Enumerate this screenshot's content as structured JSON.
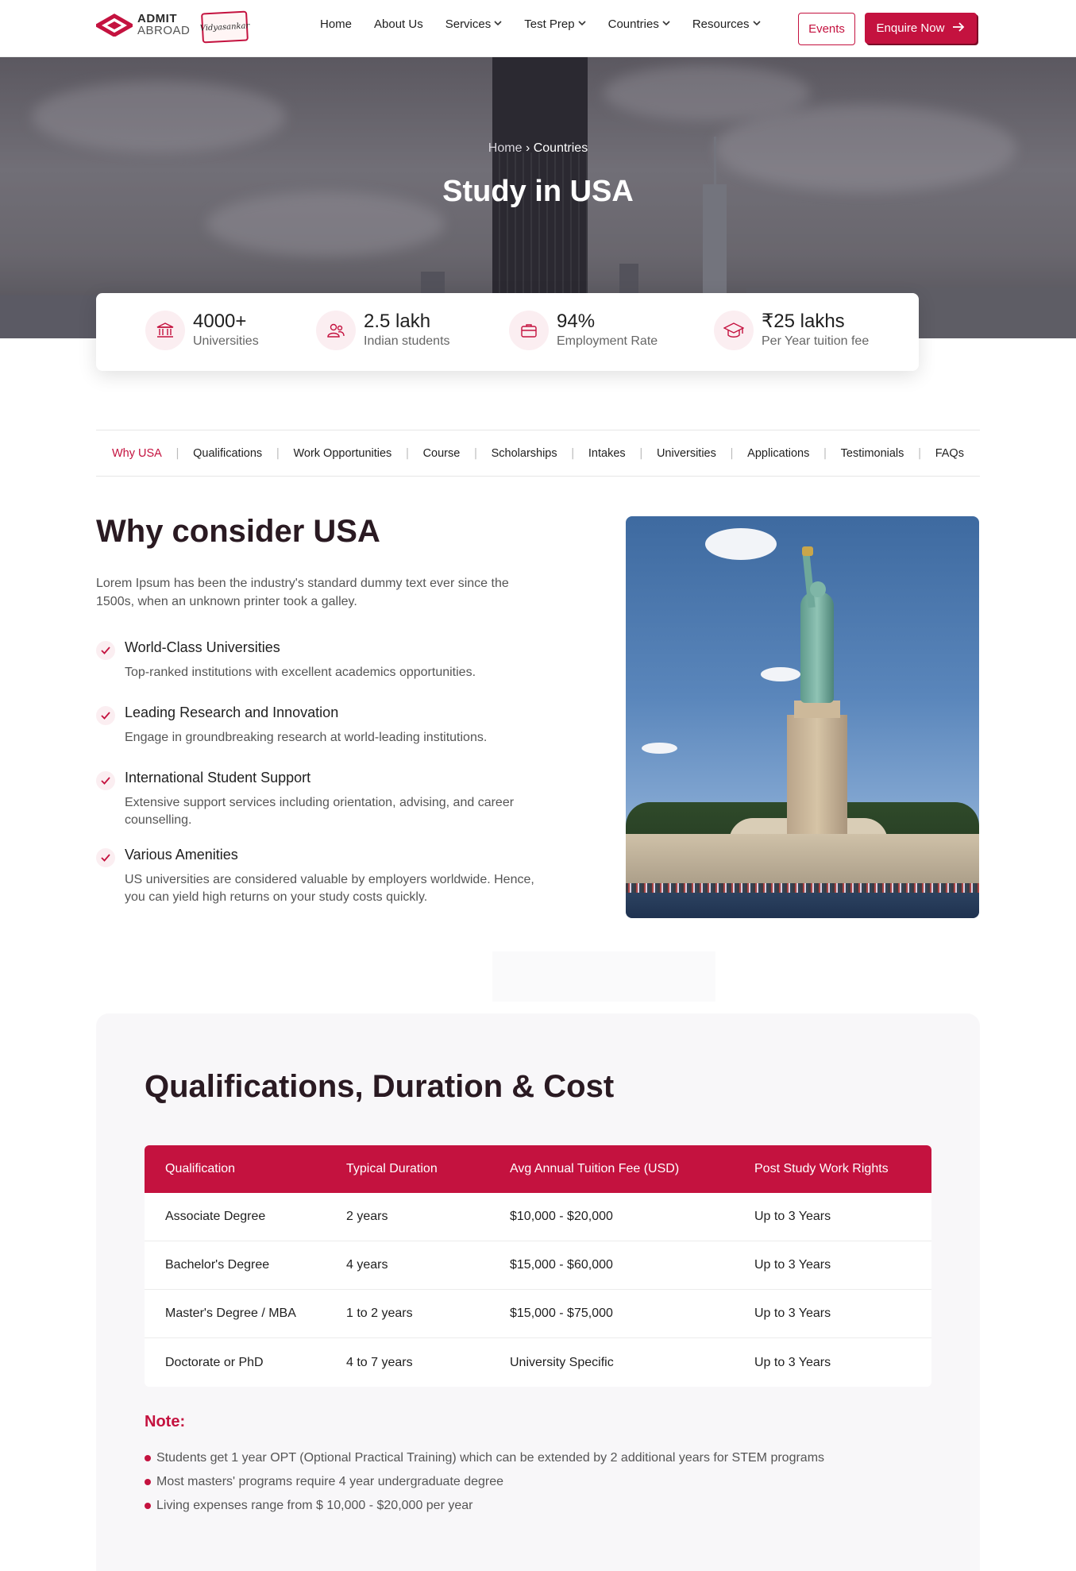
{
  "brand": {
    "logo_line1": "ADMIT",
    "logo_line2": "ABROAD",
    "badge_text": "Vidyasankar",
    "accent_color": "#c4123f"
  },
  "nav": {
    "items": [
      {
        "label": "Home",
        "dropdown": false
      },
      {
        "label": "About Us",
        "dropdown": false
      },
      {
        "label": "Services",
        "dropdown": true
      },
      {
        "label": "Test Prep",
        "dropdown": true
      },
      {
        "label": "Countries",
        "dropdown": true
      },
      {
        "label": "Resources",
        "dropdown": true
      }
    ],
    "events_label": "Events",
    "enquire_label": "Enquire Now"
  },
  "hero": {
    "breadcrumb_home": "Home",
    "breadcrumb_sep": "›",
    "breadcrumb_current": "Countries",
    "title": "Study in USA"
  },
  "stats": [
    {
      "value": "4000+",
      "label": "Universities",
      "icon": "university-icon"
    },
    {
      "value": "2.5 lakh",
      "label": "Indian students",
      "icon": "students-icon"
    },
    {
      "value": "94%",
      "label": "Employment Rate",
      "icon": "briefcase-icon"
    },
    {
      "value": "₹25 lakhs",
      "label": "Per Year tuition fee",
      "icon": "graduation-cap-icon"
    }
  ],
  "tabs": [
    "Why USA",
    "Qualifications",
    "Work Opportunities",
    "Course",
    "Scholarships",
    "Intakes",
    "Universities",
    "Applications",
    "Testimonials",
    "FAQs"
  ],
  "why": {
    "title": "Why consider USA",
    "intro": "Lorem Ipsum has been the industry's standard dummy text ever since the 1500s, when an unknown printer took a galley.",
    "features": [
      {
        "title": "World-Class Universities",
        "desc": "Top-ranked institutions with excellent academics opportunities."
      },
      {
        "title": "Leading Research and Innovation",
        "desc": "Engage in groundbreaking research at world-leading institutions."
      },
      {
        "title": "International Student Support",
        "desc": "Extensive support services including orientation, advising, and career counselling."
      },
      {
        "title": "Various Amenities",
        "desc": "US universities are considered valuable by employers worldwide. Hence, you can yield high returns on your study costs quickly."
      }
    ]
  },
  "qualifications": {
    "title": "Qualifications, Duration & Cost",
    "headers": [
      "Qualification",
      "Typical Duration",
      "Avg Annual Tuition Fee (USD)",
      "Post Study Work Rights"
    ],
    "rows": [
      [
        "Associate Degree",
        "2 years",
        "$10,000 - $20,000",
        "Up to 3 Years"
      ],
      [
        "Bachelor's Degree",
        "4 years",
        "$15,000 - $60,000",
        "Up to 3 Years"
      ],
      [
        "Master's Degree / MBA",
        "1 to 2 years",
        "$15,000 - $75,000",
        "Up to 3 Years"
      ],
      [
        "Doctorate or PhD",
        "4 to 7 years",
        "University Specific",
        "Up to 3 Years"
      ]
    ],
    "note_title": "Note:",
    "notes": [
      "Students get 1 year OPT (Optional Practical Training) which can be extended by 2 additional years for STEM programs",
      "Most masters' programs require 4 year undergraduate degree",
      "Living expenses range from $ 10,000 - $20,000 per year"
    ]
  }
}
